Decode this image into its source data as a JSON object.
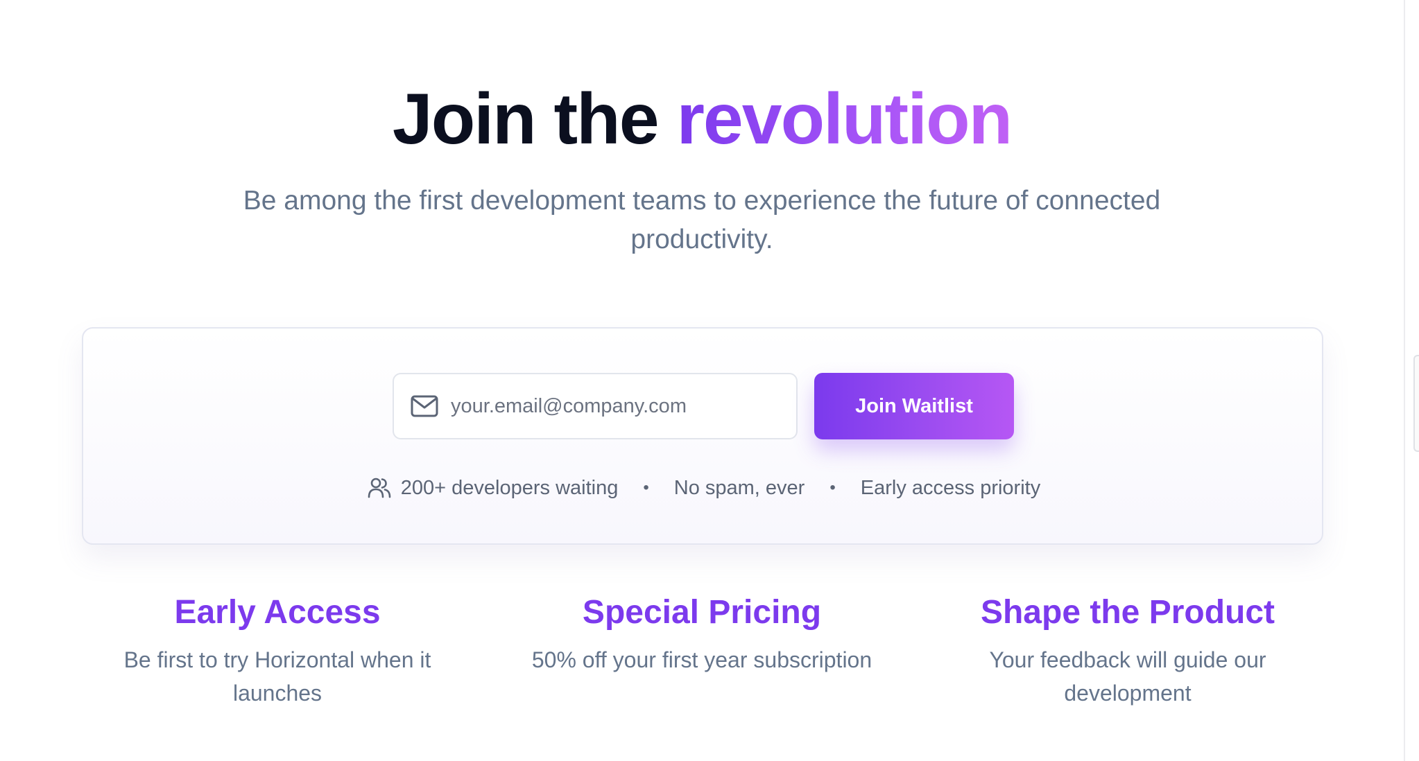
{
  "hero": {
    "title_prefix": "Join the",
    "title_accent": "revolution",
    "subtitle": "Be among the first development teams to experience the future of connected productivity."
  },
  "signup": {
    "email_placeholder": "your.email@company.com",
    "email_value": "",
    "button_label": "Join Waitlist",
    "meta": [
      "200+ developers waiting",
      "No spam, ever",
      "Early access priority"
    ],
    "meta_separator": "•"
  },
  "features": [
    {
      "title": "Early Access",
      "description": "Be first to try Horizontal when it launches"
    },
    {
      "title": "Special Pricing",
      "description": "50% off your first year subscription"
    },
    {
      "title": "Shape the Product",
      "description": "Your feedback will guide our development"
    }
  ],
  "icons": {
    "email": "mail-icon",
    "developers": "users-icon"
  },
  "colors": {
    "accent": "#7c3aed",
    "accent_light": "#b657f4",
    "heading": "#0b0f1f",
    "muted": "#64748b"
  }
}
